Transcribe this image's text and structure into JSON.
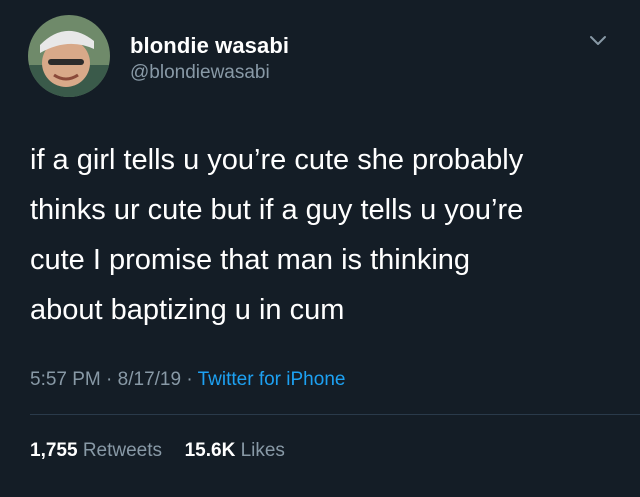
{
  "tweet": {
    "display_name": "blondie wasabi",
    "handle": "@blondiewasabi",
    "text": "if a girl tells u you’re cute she probably\nthinks ur cute but if a guy tells u you’re\ncute I promise that man is thinking\nabout baptizing u in cum",
    "time": "5:57 PM",
    "sep1": "·",
    "date": "8/17/19",
    "sep2": "·",
    "source": "Twitter for iPhone",
    "retweets_count": "1,755",
    "retweets_label": "Retweets",
    "likes_count": "15.6K",
    "likes_label": "Likes"
  },
  "icons": {
    "avatar": "avatar-photo",
    "menu": "chevron-down-icon"
  },
  "colors": {
    "background": "#141d26",
    "secondary_text": "#8899a6",
    "link": "#1da1f2"
  }
}
